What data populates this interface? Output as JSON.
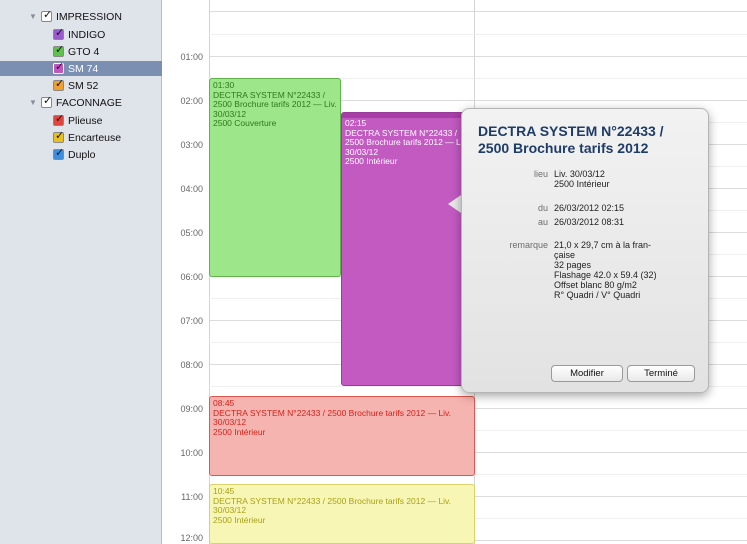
{
  "sidebar": {
    "items": [
      {
        "label": "IMPRESSION",
        "type": "group",
        "check_color": "#ffffff"
      },
      {
        "label": "INDIGO",
        "type": "calendar",
        "check_color": "#9b59d0"
      },
      {
        "label": "GTO 4",
        "type": "calendar",
        "check_color": "#5ec24a"
      },
      {
        "label": "SM 74",
        "type": "calendar",
        "check_color": "#c254c2",
        "selected": true
      },
      {
        "label": "SM 52",
        "type": "calendar",
        "check_color": "#f0a030"
      },
      {
        "label": "FACONNAGE",
        "type": "group",
        "check_color": "#ffffff"
      },
      {
        "label": "Plieuse",
        "type": "calendar",
        "check_color": "#e0443c"
      },
      {
        "label": "Encarteuse",
        "type": "calendar",
        "check_color": "#e8c020"
      },
      {
        "label": "Duplo",
        "type": "calendar",
        "check_color": "#3c8ee0"
      }
    ]
  },
  "timeline": {
    "hours": [
      "01:00",
      "02:00",
      "03:00",
      "04:00",
      "05:00",
      "06:00",
      "07:00",
      "08:00",
      "09:00",
      "10:00",
      "11:00",
      "12:00"
    ]
  },
  "events": [
    {
      "time": "01:30",
      "text": "DECTRA SYSTEM N°22433 / 2500 Brochure tarifs 2012 — Liv. 30/03/12\n2500 Couverture",
      "color": "green"
    },
    {
      "time": "02:15",
      "text": "DECTRA SYSTEM N°22433 / 2500 Brochure tarifs 2012 — Liv. 30/03/12\n2500 Intérieur",
      "color": "purple"
    },
    {
      "time": "08:45",
      "text": "DECTRA SYSTEM N°22433 / 2500 Brochure tarifs 2012 — Liv. 30/03/12\n2500 Intérieur",
      "color": "red"
    },
    {
      "time": "10:45",
      "text": "DECTRA SYSTEM N°22433 / 2500 Brochure tarifs 2012 — Liv. 30/03/12\n2500 Intérieur",
      "color": "yellow"
    }
  ],
  "popover": {
    "title": "DECTRA SYSTEM N°22433 / 2500 Brochure tarifs 2012",
    "lieu_label": "lieu",
    "lieu_value": "Liv. 30/03/12\n2500 Intérieur",
    "du_label": "du",
    "du_value": "26/03/2012 02:15",
    "au_label": "au",
    "au_value": "26/03/2012 08:31",
    "remarque_label": "remarque",
    "remarque_value": "21,0 x 29,7 cm à la fran-\nçaise\n32 pages\nFlashage 42.0 x 59.4 (32)\nOffset blanc 80 g/m2\nR° Quadri / V° Quadri",
    "modify_label": "Modifier",
    "done_label": "Terminé"
  }
}
